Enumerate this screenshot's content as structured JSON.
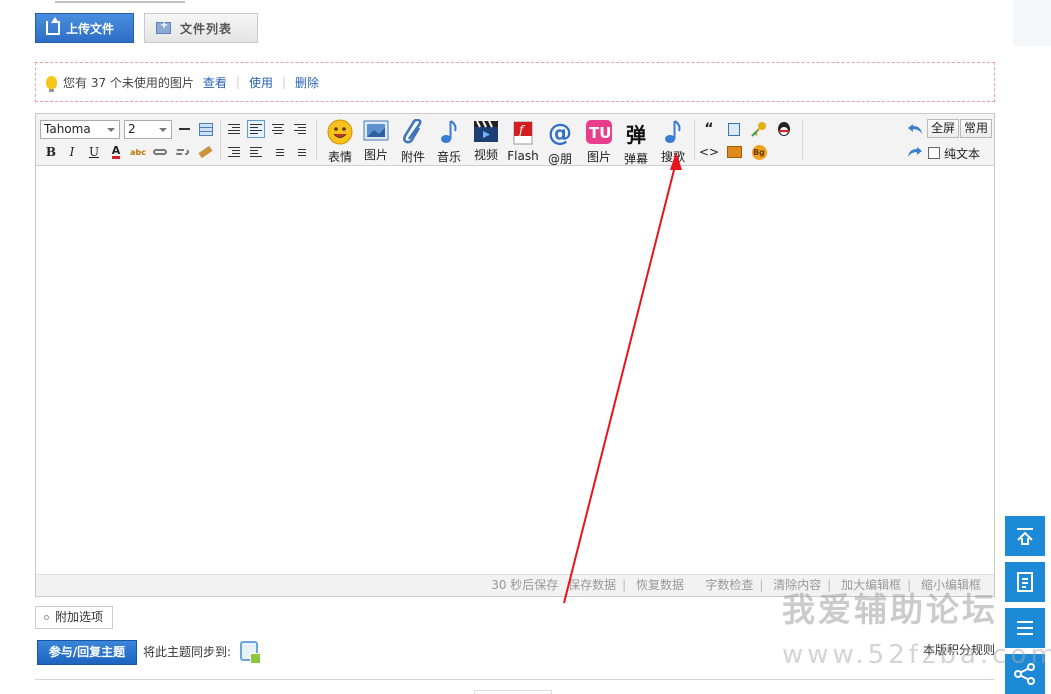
{
  "tabs": {
    "upload_label": "上传文件",
    "files_label": "文件列表"
  },
  "notice": {
    "text": "您有 37 个未使用的图片",
    "links": [
      "查看",
      "使用",
      "删除"
    ]
  },
  "toolbar": {
    "font_family": "Tahoma",
    "font_size": "2",
    "format_buttons": [
      "B",
      "I",
      "U"
    ],
    "insert_buttons": [
      "表情",
      "图片",
      "附件",
      "音乐",
      "视频",
      "Flash",
      "@朋",
      "图片",
      "弹幕",
      "搜歌"
    ],
    "fullscreen_label": "全屏",
    "common_label": "常用",
    "plaintext_label": "纯文本"
  },
  "statusbar": {
    "autosave_text": "30 秒后保存",
    "items": [
      "保存数据",
      "恢复数据",
      "字数检查",
      "清除内容",
      "加大编辑框",
      "缩小编辑框"
    ]
  },
  "bottom": {
    "additional_options_label": "附加选项",
    "reply_button_label": "参与/回复主题",
    "sync_label": "将此主题同步到:",
    "credit_rules_label": "本版积分规则"
  },
  "watermark": {
    "name": "我爱辅助论坛",
    "url": "www.52fzba.com"
  },
  "colors": {
    "accent": "#1c8ad6",
    "button_blue": "#2d6ec6",
    "annotation_arrow": "#e8141b"
  }
}
